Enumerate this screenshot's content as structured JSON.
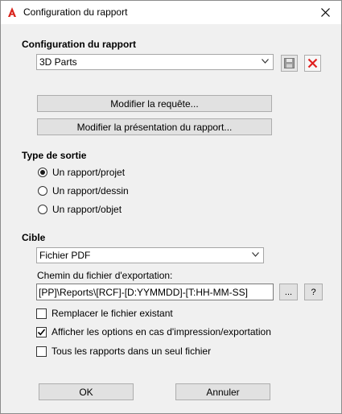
{
  "window": {
    "title": "Configuration du rapport",
    "close_icon": "close-icon"
  },
  "report_config": {
    "heading": "Configuration du rapport",
    "selected": "3D Parts",
    "save_icon": "floppy-save-icon",
    "delete_icon": "red-x-delete-icon"
  },
  "buttons": {
    "modify_query": "Modifier la requête...",
    "modify_layout": "Modifier la présentation du rapport...",
    "ok": "OK",
    "cancel": "Annuler"
  },
  "output_type": {
    "heading": "Type de sortie",
    "options": [
      {
        "label": "Un rapport/projet",
        "selected": true
      },
      {
        "label": "Un rapport/dessin",
        "selected": false
      },
      {
        "label": "Un rapport/objet",
        "selected": false
      }
    ]
  },
  "target": {
    "heading": "Cible",
    "format": "Fichier PDF",
    "path_label": "Chemin du fichier d'exportation:",
    "path_value": "[PP]\\Reports\\[RCF]-[D:YYMMDD]-[T:HH-MM-SS]",
    "browse_label": "...",
    "help_label": "?"
  },
  "options": [
    {
      "label": "Remplacer le fichier existant",
      "checked": false
    },
    {
      "label": "Afficher les options en cas d'impression/exportation",
      "checked": true
    },
    {
      "label": "Tous les rapports dans un seul fichier",
      "checked": false
    }
  ],
  "colors": {
    "accent_red": "#e0201f",
    "dialog_bg": "#f0f0f0"
  }
}
